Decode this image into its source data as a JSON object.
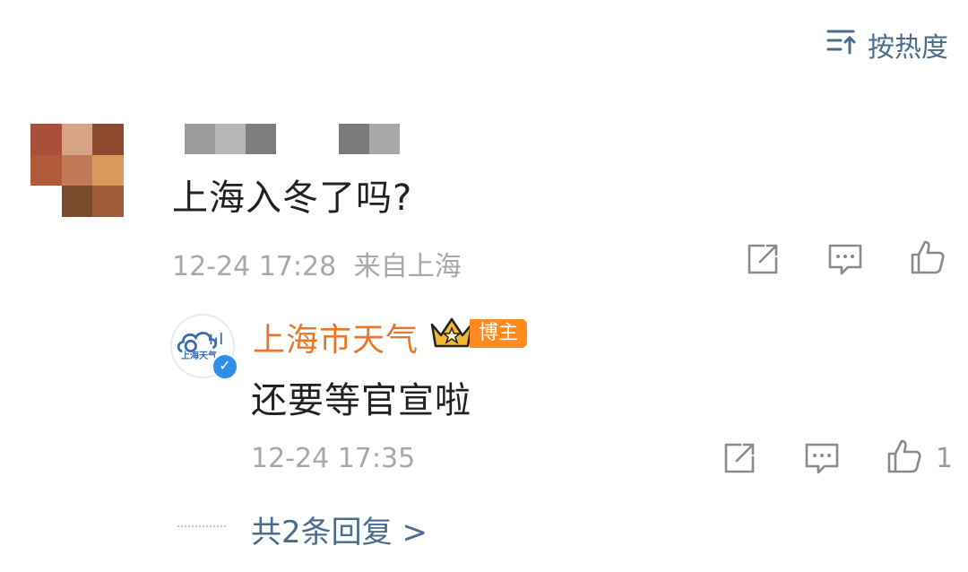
{
  "sort": {
    "label": "按热度",
    "icon": "sort-icon"
  },
  "comment": {
    "text": "上海入冬了吗?",
    "timestamp": "12-24 17:28",
    "location": "来自上海"
  },
  "reply": {
    "author": "上海市天气",
    "avatar_text": "上海天气",
    "author_badge": "博主",
    "text": "还要等官宣啦",
    "timestamp": "12-24 17:35",
    "like_count": "1"
  },
  "more_replies": {
    "count": "2",
    "label": "共2条回复 >"
  },
  "colors": {
    "link": "#4a6c8f",
    "author": "#e8762b",
    "badge": "#ff8a1e",
    "meta": "#a8a8a8"
  }
}
